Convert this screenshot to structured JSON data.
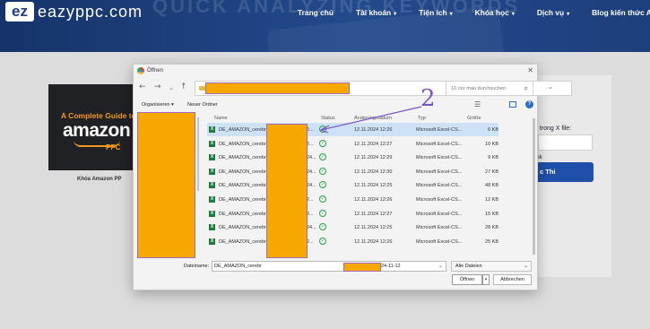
{
  "site": {
    "logo_mark": "ez",
    "logo_text": "eazyppc.com",
    "hero_watermark": "QUICK ANALYZING KEYWORDS",
    "nav": [
      {
        "label": "Trang chủ",
        "has_caret": false
      },
      {
        "label": "Tài khoản",
        "has_caret": true
      },
      {
        "label": "Tiện ích",
        "has_caret": true
      },
      {
        "label": "Khóa học",
        "has_caret": true
      },
      {
        "label": "Dịch vụ",
        "has_caret": true
      },
      {
        "label": "Blog kiến thức Amazon",
        "has_caret": false
      }
    ],
    "colors": {
      "header": "#1d3f7b",
      "accent_button": "#1f4fa8",
      "redaction": "#f6a800"
    }
  },
  "ad": {
    "line1": "A Complete Guide to",
    "brand": "amazon",
    "sub": "PPC",
    "caption": "Khóa Amazon PP"
  },
  "side": {
    "label": "n trong X file:",
    "small": "nk",
    "button": "c Thi"
  },
  "dialog": {
    "title": "Öffnen",
    "close_icon": "close-icon",
    "search_placeholder": "10 csv mau durchsuchen",
    "toolbar": {
      "organize": "Organisieren ▾",
      "new_folder": "Neuer Ordner"
    },
    "columns": {
      "name": "Name",
      "status": "Status",
      "date": "Änderungsdatum",
      "type": "Typ",
      "size": "Größe"
    },
    "files": [
      {
        "name": "DE_AMAZON_cerebr",
        "tail": "2...",
        "date": "12.11.2024 12:26",
        "type": "Microsoft Excel-CS...",
        "size": "6 KB",
        "selected": true
      },
      {
        "name": "DE_AMAZON_cerebr",
        "tail": "2...",
        "date": "12.11.2024 12:27",
        "type": "Microsoft Excel-CS...",
        "size": "10 KB"
      },
      {
        "name": "DE_AMAZON_cerebr",
        "tail": "24...",
        "date": "12.11.2024 12:29",
        "type": "Microsoft Excel-CS...",
        "size": "9 KB"
      },
      {
        "name": "DE_AMAZON_cerebr",
        "tail": "24...",
        "date": "12.11.2024 12:30",
        "type": "Microsoft Excel-CS...",
        "size": "27 KB"
      },
      {
        "name": "DE_AMAZON_cerebr",
        "tail": "24...",
        "date": "12.11.2024 12:25",
        "type": "Microsoft Excel-CS...",
        "size": "48 KB"
      },
      {
        "name": "DE_AMAZON_cerebr",
        "tail": "2...",
        "date": "12.11.2024 12:26",
        "type": "Microsoft Excel-CS...",
        "size": "12 KB"
      },
      {
        "name": "DE_AMAZON_cerebr",
        "tail": "2...",
        "date": "12.11.2024 12:27",
        "type": "Microsoft Excel-CS...",
        "size": "15 KB"
      },
      {
        "name": "DE_AMAZON_cerebr",
        "tail": "24...",
        "date": "12.11.2024 12:25",
        "type": "Microsoft Excel-CS...",
        "size": "28 KB"
      },
      {
        "name": "DE_AMAZON_cerebr",
        "tail": "2...",
        "date": "12.11.2024 12:26",
        "type": "Microsoft Excel-CS...",
        "size": "25 KB"
      }
    ],
    "filename_label": "Dateiname:",
    "filename_prefix": "DE_AMAZON_cerebr",
    "filename_suffix": "24-11-12",
    "filter": "Alle Dateien",
    "open_button": "Öffnen",
    "cancel_button": "Abbrechen",
    "annotation_mark": "2"
  }
}
